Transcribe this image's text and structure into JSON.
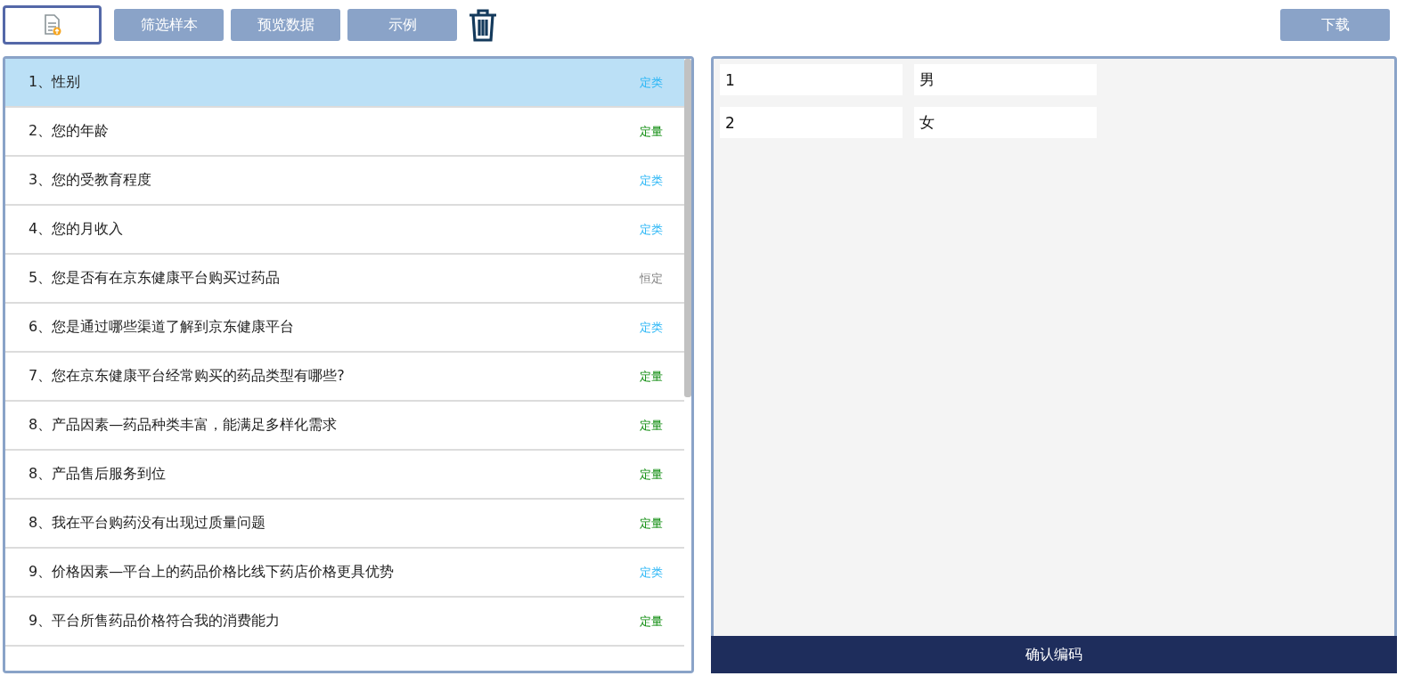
{
  "toolbar": {
    "buttons": [
      "筛选样本",
      "预览数据",
      "示例"
    ],
    "download": "下载"
  },
  "questions": [
    {
      "label": "1、性别",
      "type": "定类",
      "kind": "nominal",
      "selected": true
    },
    {
      "label": "2、您的年龄",
      "type": "定量",
      "kind": "quantitative",
      "selected": false
    },
    {
      "label": "3、您的受教育程度",
      "type": "定类",
      "kind": "nominal",
      "selected": false
    },
    {
      "label": "4、您的月收入",
      "type": "定类",
      "kind": "nominal",
      "selected": false
    },
    {
      "label": "5、您是否有在京东健康平台购买过药品",
      "type": "恒定",
      "kind": "constant",
      "selected": false
    },
    {
      "label": "6、您是通过哪些渠道了解到京东健康平台",
      "type": "定类",
      "kind": "nominal",
      "selected": false
    },
    {
      "label": "7、您在京东健康平台经常购买的药品类型有哪些?",
      "type": "定量",
      "kind": "quantitative",
      "selected": false
    },
    {
      "label": "8、产品因素—药品种类丰富，能满足多样化需求",
      "type": "定量",
      "kind": "quantitative",
      "selected": false
    },
    {
      "label": "8、产品售后服务到位",
      "type": "定量",
      "kind": "quantitative",
      "selected": false
    },
    {
      "label": "8、我在平台购药没有出现过质量问题",
      "type": "定量",
      "kind": "quantitative",
      "selected": false
    },
    {
      "label": "9、价格因素—平台上的药品价格比线下药店价格更具优势",
      "type": "定类",
      "kind": "nominal",
      "selected": false
    },
    {
      "label": "9、平台所售药品价格符合我的消费能力",
      "type": "定量",
      "kind": "quantitative",
      "selected": false
    }
  ],
  "codes": [
    {
      "code": "1",
      "value": "男"
    },
    {
      "code": "2",
      "value": "女"
    }
  ],
  "confirm": "确认编码"
}
